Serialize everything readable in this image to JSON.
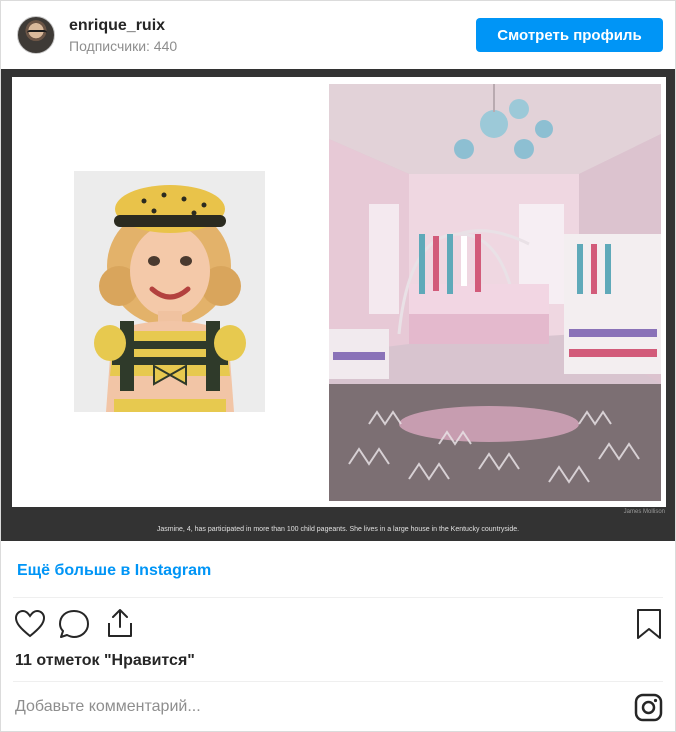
{
  "header": {
    "username": "enrique_ruix",
    "followers": "Подписчики: 440",
    "view_profile_label": "Смотреть профиль"
  },
  "post": {
    "caption": "Jasmine, 4, has participated in more than 100 child pageants. She lives in a large house in the Kentucky countryside.",
    "credit": "James Mollison",
    "more_link": "Ещё больше в Instagram",
    "likes": "11 отметок \"Нравится\"",
    "comment_placeholder": "Добавьте комментарий..."
  },
  "icons": {
    "like": "heart-icon",
    "comment": "comment-icon",
    "share": "share-icon",
    "save": "bookmark-icon",
    "instagram": "instagram-icon"
  },
  "colors": {
    "accent": "#0095f6",
    "media_background": "#333333",
    "muted_text": "#8e8e8e"
  }
}
